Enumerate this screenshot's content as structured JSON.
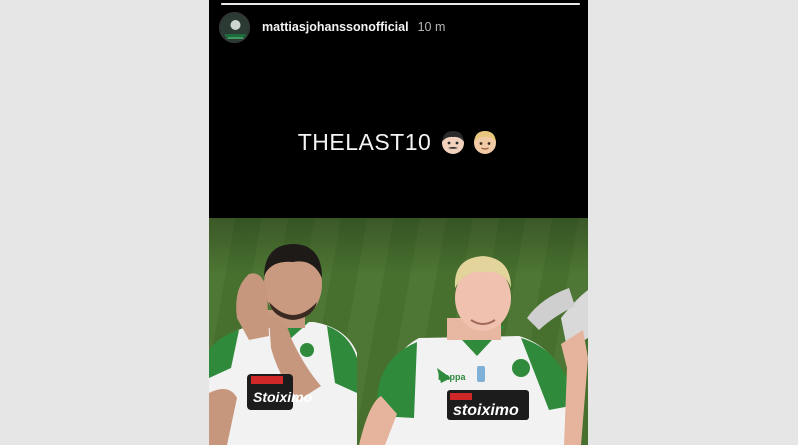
{
  "story": {
    "username": "mattiasjohanssonofficial",
    "timestamp": "10 m",
    "progress": 1.0,
    "caption_text": "THELAST10",
    "caption_emojis": [
      "man-emoji",
      "blond-person-emoji"
    ],
    "photo": {
      "left_shirt_sponsor": "Stoiximo",
      "right_shirt_sponsor": "stoiximo",
      "kit_brand": "Kappa"
    }
  },
  "colors": {
    "story_background": "#000000",
    "page_background": "#e6e6e6",
    "pitch_green": "#4a7432",
    "kit_green": "#2f8a3c"
  }
}
